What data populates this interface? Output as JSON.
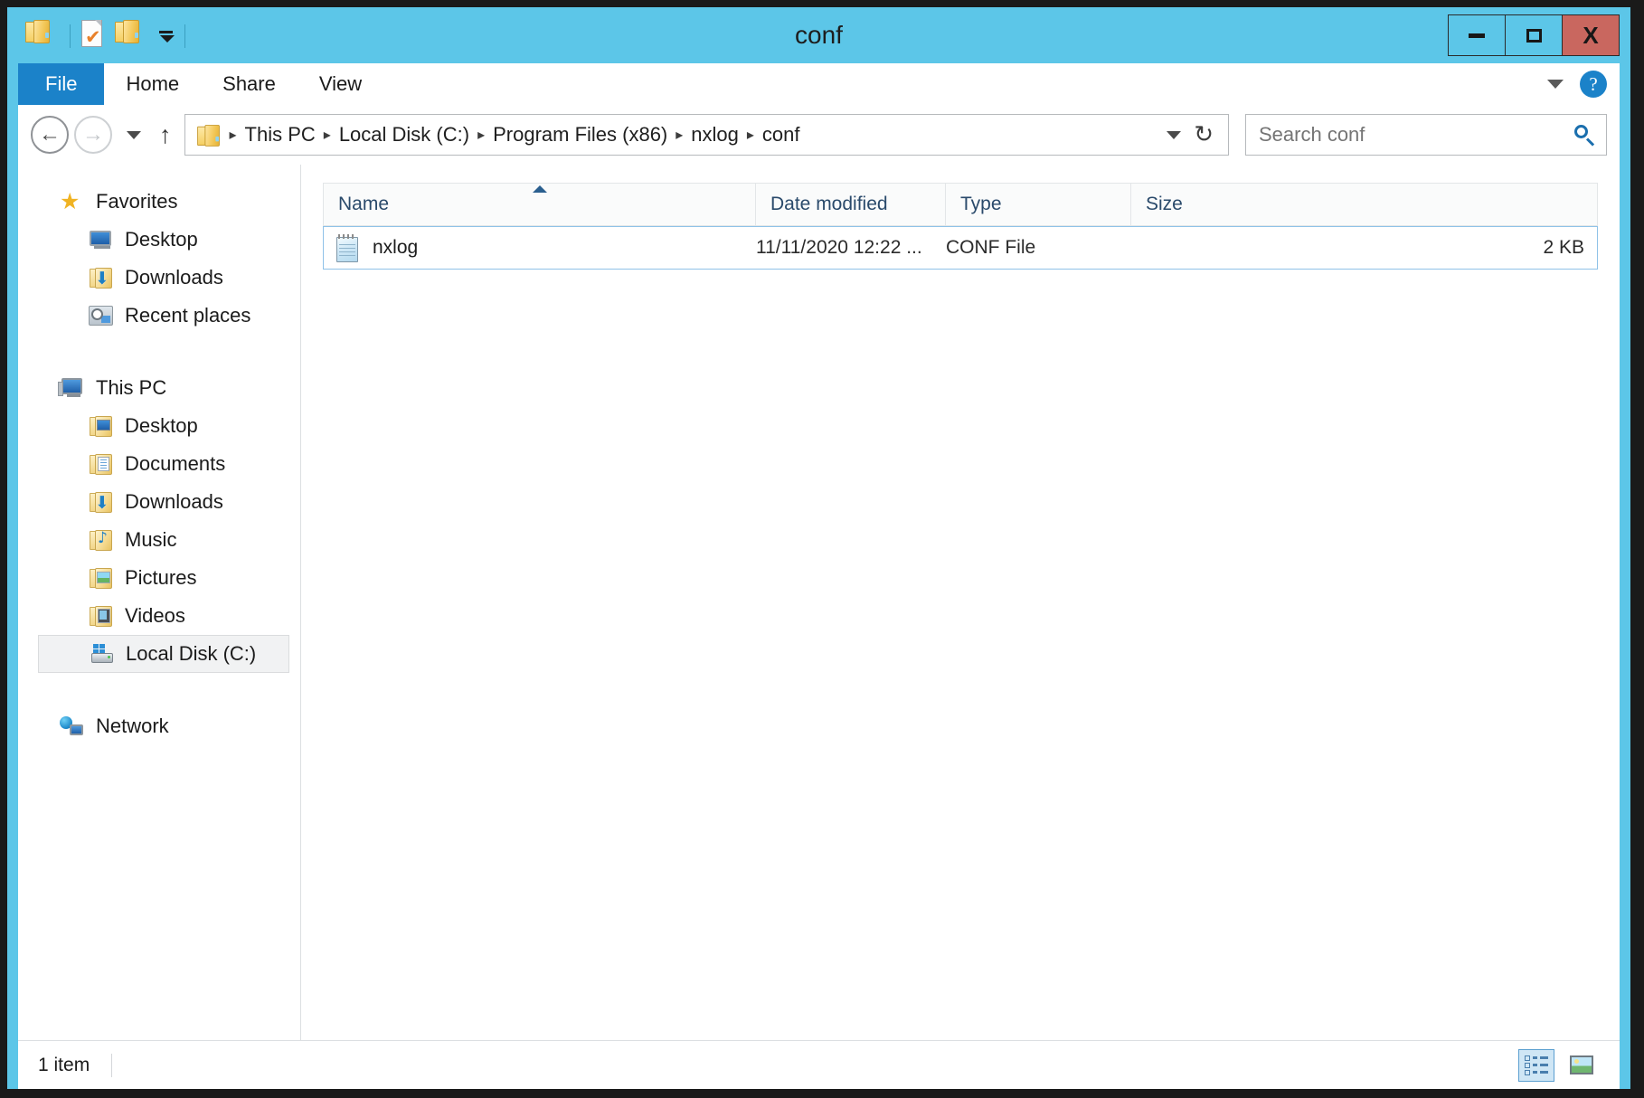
{
  "window": {
    "title": "conf",
    "controls": {
      "minimize": "–",
      "maximize": "□",
      "close": "X"
    }
  },
  "quick_access": {
    "items": [
      {
        "name": "folder-icon",
        "label": "Folder"
      },
      {
        "name": "properties-icon",
        "label": "Properties"
      },
      {
        "name": "new-folder-icon",
        "label": "New folder"
      },
      {
        "name": "customize-dropdown-icon",
        "label": "Customize Quick Access Toolbar"
      }
    ]
  },
  "ribbon": {
    "tabs": [
      {
        "label": "File",
        "active": true
      },
      {
        "label": "Home",
        "active": false
      },
      {
        "label": "Share",
        "active": false
      },
      {
        "label": "View",
        "active": false
      }
    ],
    "minimize_ribbon": "⌄",
    "help": "?"
  },
  "address_bar": {
    "back": "←",
    "forward": "→",
    "recent_dropdown": "▾",
    "up": "↑",
    "breadcrumb": [
      "This PC",
      "Local Disk (C:)",
      "Program Files (x86)",
      "nxlog",
      "conf"
    ],
    "separator": "▸",
    "history_chevron": "⌄",
    "refresh": "↻"
  },
  "search": {
    "placeholder": "Search conf",
    "value": ""
  },
  "sidebar": {
    "groups": [
      {
        "name": "favorites",
        "root": {
          "label": "Favorites",
          "icon": "star-icon"
        },
        "children": [
          {
            "label": "Desktop",
            "icon": "monitor-icon"
          },
          {
            "label": "Downloads",
            "icon": "downloads-folder-icon"
          },
          {
            "label": "Recent places",
            "icon": "recent-places-icon"
          }
        ]
      },
      {
        "name": "this-pc",
        "root": {
          "label": "This PC",
          "icon": "computer-icon"
        },
        "children": [
          {
            "label": "Desktop",
            "icon": "desktop-folder-icon"
          },
          {
            "label": "Documents",
            "icon": "documents-folder-icon"
          },
          {
            "label": "Downloads",
            "icon": "downloads-folder-icon"
          },
          {
            "label": "Music",
            "icon": "music-folder-icon"
          },
          {
            "label": "Pictures",
            "icon": "pictures-folder-icon"
          },
          {
            "label": "Videos",
            "icon": "videos-folder-icon"
          },
          {
            "label": "Local Disk (C:)",
            "icon": "disk-drive-icon",
            "selected": true
          }
        ]
      },
      {
        "name": "network",
        "root": {
          "label": "Network",
          "icon": "network-icon"
        },
        "children": []
      }
    ]
  },
  "file_list": {
    "columns": [
      {
        "label": "Name",
        "sorted": "asc"
      },
      {
        "label": "Date modified",
        "sorted": ""
      },
      {
        "label": "Type",
        "sorted": ""
      },
      {
        "label": "Size",
        "sorted": ""
      }
    ],
    "rows": [
      {
        "name": "nxlog",
        "date_modified": "11/11/2020 12:22 ...",
        "type": "CONF File",
        "size": "2 KB",
        "icon": "notepad-file-icon",
        "selected": true
      }
    ]
  },
  "status_bar": {
    "item_count": "1 item",
    "views": [
      {
        "name": "details-view-button",
        "active": true
      },
      {
        "name": "large-icons-view-button",
        "active": false
      }
    ]
  }
}
